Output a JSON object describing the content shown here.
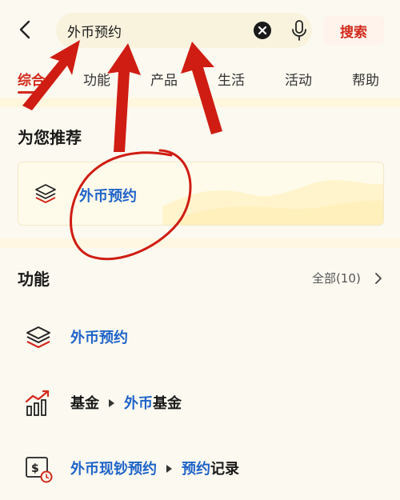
{
  "search": {
    "value": "外币预约",
    "button_label": "搜索"
  },
  "tabs": [
    {
      "label": "综合",
      "active": true
    },
    {
      "label": "功能"
    },
    {
      "label": "产品"
    },
    {
      "label": "生活"
    },
    {
      "label": "活动"
    },
    {
      "label": "帮助"
    }
  ],
  "recommend": {
    "title": "为您推荐",
    "card_label": "外币预约",
    "card_icon": "layers-icon"
  },
  "features": {
    "title": "功能",
    "all_label": "全部(10)",
    "items": [
      {
        "icon": "layers-icon",
        "parts": [
          "外币预约"
        ]
      },
      {
        "icon": "fund-chart-icon",
        "parts": [
          "基金",
          "外币",
          "基金"
        ]
      },
      {
        "icon": "cash-reservation-icon",
        "parts": [
          "外币现钞",
          "预约",
          "预约",
          "记录"
        ]
      }
    ]
  },
  "colors": {
    "accent_red": "#d22a1c",
    "link_blue": "#1e63c8",
    "background": "#fbf9f0",
    "annotation_red": "#cf1d13"
  }
}
